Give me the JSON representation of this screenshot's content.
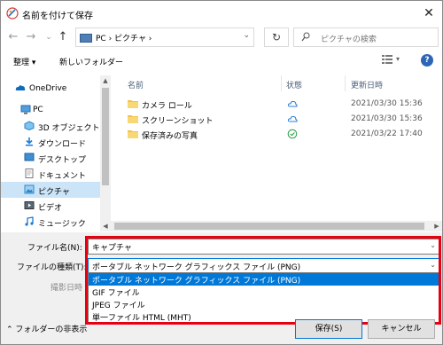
{
  "window": {
    "title": "名前を付けて保存",
    "close_glyph": "✕"
  },
  "nav": {
    "back": "←",
    "forward": "→",
    "dropdown": "⌄",
    "up": "↑"
  },
  "address": {
    "crumbs": "PC  ›  ピクチャ  ›",
    "dropdown": "⌄"
  },
  "refresh_glyph": "↻",
  "search": {
    "placeholder": "ピクチャの検索"
  },
  "toolbar": {
    "organize": "整理 ▾",
    "new_folder": "新しいフォルダー",
    "view_dropdown": "▾",
    "help": "?"
  },
  "sidebar": {
    "items": [
      {
        "label": "OneDrive",
        "icon": "onedrive-icon"
      },
      {
        "label": "PC",
        "icon": "pc-icon"
      },
      {
        "label": "3D オブジェクト",
        "icon": "3d-objects-icon"
      },
      {
        "label": "ダウンロード",
        "icon": "download-icon"
      },
      {
        "label": "デスクトップ",
        "icon": "desktop-icon"
      },
      {
        "label": "ドキュメント",
        "icon": "documents-icon"
      },
      {
        "label": "ピクチャ",
        "icon": "pictures-icon",
        "selected": true
      },
      {
        "label": "ビデオ",
        "icon": "videos-icon"
      },
      {
        "label": "ミュージック",
        "icon": "music-icon"
      }
    ]
  },
  "columns": {
    "name": "名前",
    "status": "状態",
    "modified": "更新日時"
  },
  "files": [
    {
      "name": "カメラ ロール",
      "status": "cloud-icon",
      "modified": "2021/03/30 15:36"
    },
    {
      "name": "スクリーンショット",
      "status": "cloud-icon",
      "modified": "2021/03/30 15:36"
    },
    {
      "name": "保存済みの写真",
      "status": "synced-check-icon",
      "modified": "2021/03/22 17:40"
    }
  ],
  "form": {
    "filename_label": "ファイル名(N):",
    "filename_value": "キャプチャ",
    "filetype_label": "ファイルの種類(T):",
    "filetype_value": "ポータブル ネットワーク グラフィックス ファイル (PNG)",
    "date_label": "撮影日時",
    "dropdown_glyph": "⌄",
    "options": [
      "ポータブル ネットワーク グラフィックス ファイル (PNG)",
      "GIF ファイル",
      "JPEG ファイル",
      "単一ファイル HTML (MHT)"
    ]
  },
  "footer": {
    "hide_folders": "フォルダーの非表示",
    "save": "保存(S)",
    "cancel": "キャンセル"
  },
  "colors": {
    "accent": "#0078d7",
    "highlight": "#e60012",
    "selection": "#cce4f7"
  }
}
